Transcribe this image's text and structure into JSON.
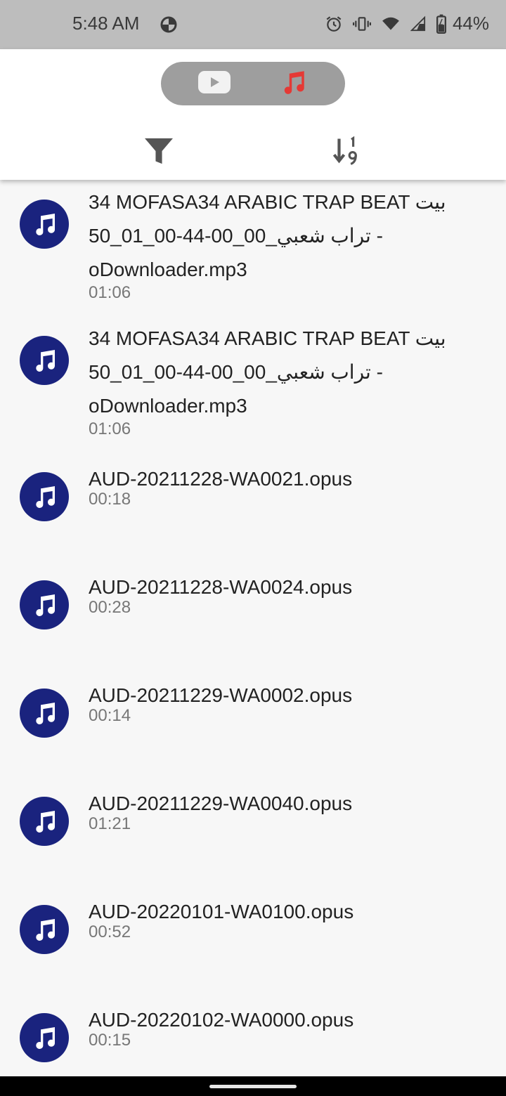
{
  "status_bar": {
    "time": "5:48 AM",
    "battery": "44%",
    "icons": [
      "data-saver-icon",
      "alarm-icon",
      "vibrate-icon",
      "wifi-icon",
      "signal-icon",
      "battery-icon"
    ]
  },
  "header": {
    "toggle": {
      "options": [
        "youtube-icon",
        "music-note-icon"
      ],
      "selected": "music-note-icon"
    },
    "tools": [
      "filter-icon",
      "sort-numeric-icon"
    ]
  },
  "colors": {
    "accent": "#e53935",
    "avatar": "#1a237e",
    "header_bg": "#ffffff",
    "status_bg": "#bdbdbd"
  },
  "files": [
    {
      "title": "34 MOFASA34 ARABIC TRAP BEAT بيت تراب شعبي_00_00-44-00_01_50 - oDownloader.mp3",
      "duration": "01:06"
    },
    {
      "title": "34 MOFASA34 ARABIC TRAP BEAT بيت تراب شعبي_00_00-44-00_01_50 - oDownloader.mp3",
      "duration": "01:06"
    },
    {
      "title": "AUD-20211228-WA0021.opus",
      "duration": "00:18"
    },
    {
      "title": "AUD-20211228-WA0024.opus",
      "duration": "00:28"
    },
    {
      "title": "AUD-20211229-WA0002.opus",
      "duration": "00:14"
    },
    {
      "title": "AUD-20211229-WA0040.opus",
      "duration": "01:21"
    },
    {
      "title": "AUD-20220101-WA0100.opus",
      "duration": "00:52"
    },
    {
      "title": "AUD-20220102-WA0000.opus",
      "duration": "00:15"
    }
  ]
}
